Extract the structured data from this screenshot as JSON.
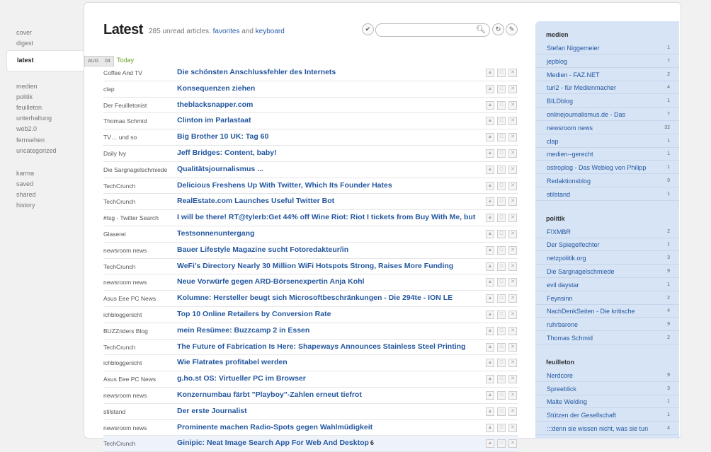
{
  "nav": {
    "group1": [
      "cover",
      "digest"
    ],
    "active": "latest",
    "group2": [
      "medien",
      "politik",
      "feuilleton",
      "unterhaltung",
      "web2.0",
      "fernsehen",
      "uncategorized"
    ],
    "group3": [
      "karma",
      "saved",
      "shared",
      "history"
    ]
  },
  "header": {
    "title": "Latest",
    "unread_text": "285 unread articles.",
    "favorites_link": "favorites",
    "and_text": "and",
    "keyboard_link": "keyboard"
  },
  "toolbar": {
    "mark_read_icon": "checkmark-icon",
    "search_placeholder": "",
    "search_icon": "magnifier-icon",
    "refresh_icon": "refresh-icon",
    "edit_icon": "pencil-icon"
  },
  "date": {
    "month": "AUG",
    "day": "04",
    "label": "Today"
  },
  "articles": [
    {
      "source": "Coffee And TV",
      "title": "Die schönsten Anschlussfehler des Internets"
    },
    {
      "source": "clap",
      "title": "Konsequenzen ziehen"
    },
    {
      "source": "Der Feuilletonist",
      "title": "theblacksnapper.com"
    },
    {
      "source": "Thomas Schmid",
      "title": "Clinton im Parlastaat"
    },
    {
      "source": "TV… und so",
      "title": "Big Brother 10 UK: Tag 60"
    },
    {
      "source": "Daily Ivy",
      "title": "Jeff Bridges: Content, baby!"
    },
    {
      "source": "Die Sargnagelschmiede",
      "title": "Qualitätsjournalismus ..."
    },
    {
      "source": "TechCrunch",
      "title": "Delicious Freshens Up With Twitter, Which Its Founder Hates"
    },
    {
      "source": "TechCrunch",
      "title": "RealEstate.com Launches Useful Twitter Bot"
    },
    {
      "source": "#tsg - Twitter Search",
      "title": "I will be there! RT@tylerb:Get 44% off Wine Riot: Riot I tickets from Buy With Me, but"
    },
    {
      "source": "Glaserei",
      "title": "Testsonnenuntergang"
    },
    {
      "source": "newsroom news",
      "title": "Bauer Lifestyle Magazine sucht Fotoredakteur/in"
    },
    {
      "source": "TechCrunch",
      "title": "WeFi’s Directory Nearly 30 Million WiFi Hotspots Strong, Raises More Funding"
    },
    {
      "source": "newsroom news",
      "title": "Neue Vorwürfe gegen ARD-Börsenexpertin Anja Kohl"
    },
    {
      "source": "Asus Eee PC News",
      "title": "Kolumne: Hersteller beugt sich Microsoftbeschränkungen - Die 294te - ION LE"
    },
    {
      "source": "ichbloggenicht",
      "title": "Top 10 Online Retailers by Conversion Rate"
    },
    {
      "source": "BUZZriders Blog",
      "title": "mein Resümee: Buzzcamp 2 in Essen"
    },
    {
      "source": "TechCrunch",
      "title": "The Future of Fabrication Is Here: Shapeways Announces Stainless Steel Printing"
    },
    {
      "source": "ichbloggenicht",
      "title": "Wie Flatrates profitabel werden"
    },
    {
      "source": "Asus Eee PC News",
      "title": "g.ho.st OS: Virtueller PC im Browser"
    },
    {
      "source": "newsroom news",
      "title": "Konzernumbau färbt \"Playboy\"-Zahlen erneut tiefrot"
    },
    {
      "source": "stilstand",
      "title": "Der erste Journalist"
    },
    {
      "source": "newsroom news",
      "title": "Prominente machen Radio-Spots gegen Wahlmüdigkeit"
    },
    {
      "source": "TechCrunch",
      "title": "Ginipic: Neat Image Search App For Web And Desktop",
      "count": "6"
    }
  ],
  "sidebar": {
    "categories": [
      {
        "name": "medien",
        "feeds": [
          {
            "name": "Stefan Niggemeier",
            "count": "1"
          },
          {
            "name": "jepblog",
            "count": "7"
          },
          {
            "name": "Medien - FAZ.NET",
            "count": "2"
          },
          {
            "name": "turi2 - für Medienmacher",
            "count": "4"
          },
          {
            "name": "BILDblog",
            "count": "1"
          },
          {
            "name": "onlinejournalismus.de - Das",
            "count": "7"
          },
          {
            "name": "newsroom news",
            "count": "32"
          },
          {
            "name": "clap",
            "count": "1"
          },
          {
            "name": "medien--gerecht",
            "count": "1"
          },
          {
            "name": "ostroplog - Das Weblog von Philipp",
            "count": "1"
          },
          {
            "name": "Redaktionsblog",
            "count": "9"
          },
          {
            "name": "stilstand",
            "count": "1"
          }
        ]
      },
      {
        "name": "politik",
        "feeds": [
          {
            "name": "F!XMBR",
            "count": "2"
          },
          {
            "name": "Der Spiegelfechter",
            "count": "1"
          },
          {
            "name": "netzpolitik.org",
            "count": "3"
          },
          {
            "name": "Die Sargnagelschmiede",
            "count": "9"
          },
          {
            "name": "evil daystar",
            "count": "1"
          },
          {
            "name": "Feynsinn",
            "count": "2"
          },
          {
            "name": "NachDenkSeiten - Die kritische",
            "count": "4"
          },
          {
            "name": "ruhrbarone",
            "count": "9"
          },
          {
            "name": "Thomas Schmid",
            "count": "2"
          }
        ]
      },
      {
        "name": "feuilleton",
        "feeds": [
          {
            "name": "Nerdcore",
            "count": "9"
          },
          {
            "name": "Spreeblick",
            "count": "3"
          },
          {
            "name": "Malte Welding",
            "count": "1"
          },
          {
            "name": "Stützen der Gesellschaft",
            "count": "1"
          },
          {
            "name": ":::denn sie wissen nicht, was sie tun",
            "count": "4"
          }
        ]
      }
    ]
  },
  "colors": {
    "link": "#24579f",
    "sidebar_bg": "#d6e4f6",
    "today": "#6aa02a"
  }
}
